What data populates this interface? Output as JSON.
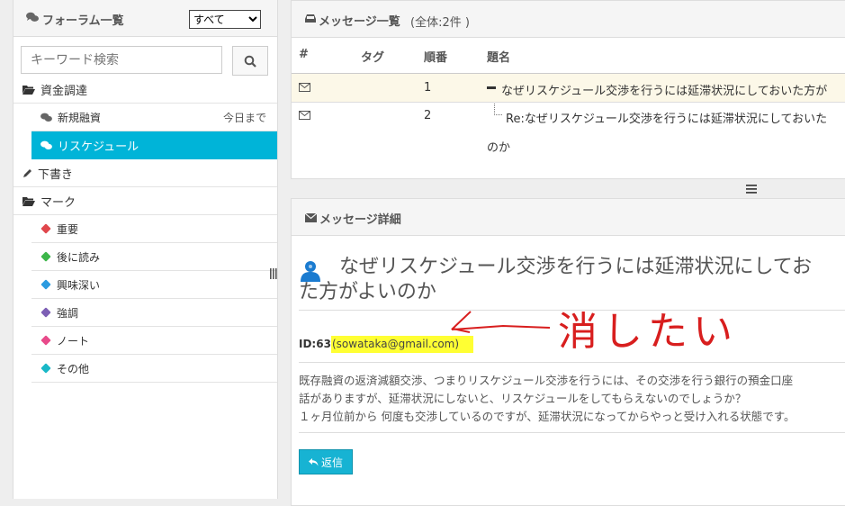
{
  "sidebar": {
    "title": "フォーラム一覧",
    "select_value": "すべて",
    "search_placeholder": "キーワード検索",
    "items": [
      {
        "label": "資金調達"
      },
      {
        "label": "新規融資",
        "meta": "今日まで"
      },
      {
        "label": "リスケジュール"
      },
      {
        "label": "下書き"
      },
      {
        "label": "マーク"
      }
    ],
    "marks": [
      {
        "label": "重要",
        "color": "#e0474c"
      },
      {
        "label": "後に読み",
        "color": "#3cb64a"
      },
      {
        "label": "興味深い",
        "color": "#2b9be0"
      },
      {
        "label": "強調",
        "color": "#7d5fb5"
      },
      {
        "label": "ノート",
        "color": "#e84a8a"
      },
      {
        "label": "その他",
        "color": "#1ab8c7"
      }
    ]
  },
  "message_list": {
    "title": "メッセージ一覧",
    "count": "(全体:2件 )",
    "columns": [
      "#",
      "タグ",
      "順番",
      "題名"
    ],
    "rows": [
      {
        "order": "1",
        "subject": "なぜリスケジュール交渉を行うには延滞状況にしておいた方が"
      },
      {
        "order": "2",
        "subject": "Re:なぜリスケジュール交渉を行うには延滞状況にしておいた",
        "subject_cont": "のか"
      }
    ]
  },
  "detail": {
    "title": "メッセージ詳細",
    "subject_line1": "なぜリスケジュール交渉を行うには延滞状況にしてお",
    "subject_line2": "た方がよいのか",
    "id_label": "ID:63",
    "email": "(sowataka@gmail.com)",
    "annotation": "消したい",
    "body": [
      "既存融資の返済減額交渉、つまりリスケジュール交渉を行うには、その交渉を行う銀行の預金口座",
      "話がありますが、延滞状況にしないと、リスケジュールをしてもらえないのでしょうか？",
      "１ヶ月位前から 何度も交渉しているのですが、延滞状況になってからやっと受け入れる状態です。"
    ],
    "reply_label": "返信"
  }
}
